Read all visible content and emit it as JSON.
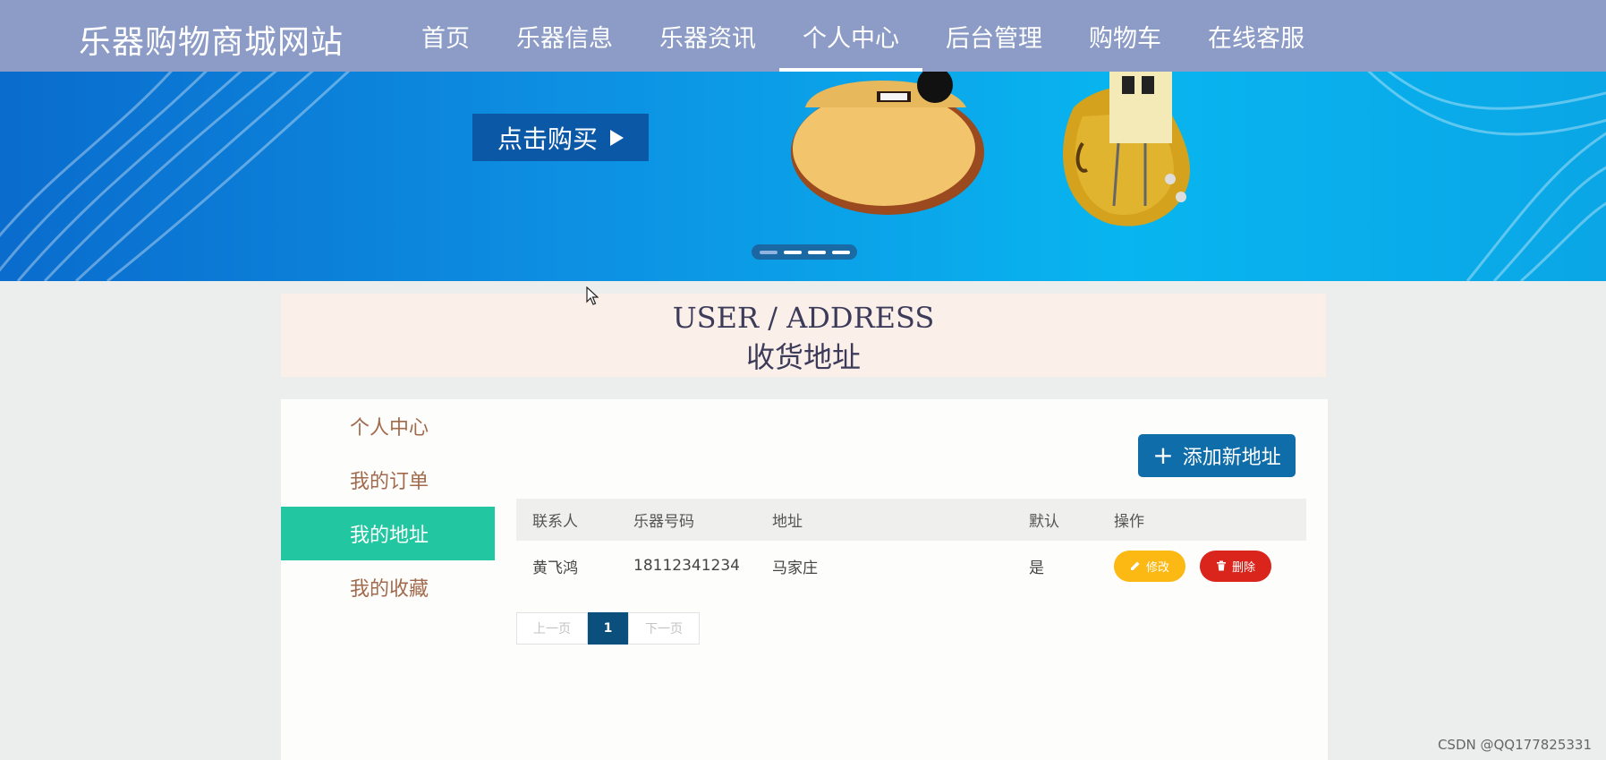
{
  "header": {
    "site_title": "乐器购物商城网站",
    "nav": [
      "首页",
      "乐器信息",
      "乐器资讯",
      "个人中心",
      "后台管理",
      "购物车",
      "在线客服"
    ],
    "active_nav_index": 3
  },
  "banner": {
    "buy_label": "点击购买",
    "slide_count": 4,
    "active_slide_index": 0
  },
  "section": {
    "title_en": "USER / ADDRESS",
    "title_cn": "收货地址"
  },
  "sidebar": {
    "items": [
      "个人中心",
      "我的订单",
      "我的地址",
      "我的收藏"
    ],
    "active_index": 2
  },
  "actions": {
    "add_label": "添加新地址"
  },
  "table": {
    "headers": [
      "联系人",
      "乐器号码",
      "地址",
      "默认",
      "操作"
    ],
    "rows": [
      {
        "contact": "黄飞鸿",
        "phone": "18112341234",
        "address": "马家庄",
        "default": "是",
        "edit": "修改",
        "delete": "删除"
      }
    ]
  },
  "pagination": {
    "prev": "上一页",
    "current": "1",
    "next": "下一页"
  },
  "watermark": "CSDN @QQ177825331",
  "colors": {
    "header_bg": "#8c9cc6",
    "active_sidebar": "#22c6a1",
    "primary_button": "#0f6daa",
    "edit_button": "#fcb813",
    "delete_button": "#d9251c",
    "page_current": "#0b4f7c"
  }
}
